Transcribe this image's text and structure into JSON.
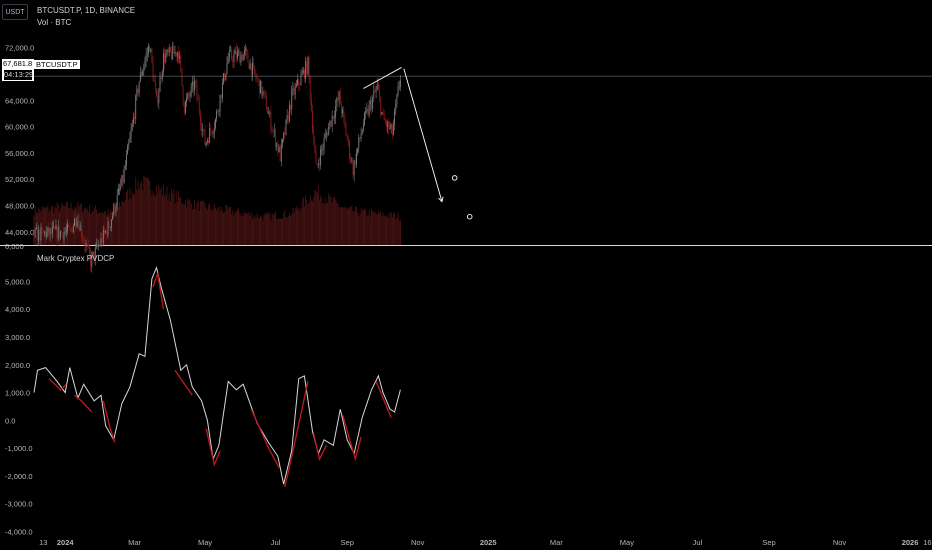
{
  "header": {
    "currency_button": "USDT",
    "symbol_line": "BTCUSDT.P, 1D, BINANCE",
    "volume_line": "Vol · BTC",
    "indicator_line": "Mark Cryptex PVDCP"
  },
  "price_badge": {
    "price": "67,681.8",
    "countdown": "04:13:29",
    "symbol_tag": "BTCUSDT.P"
  },
  "colors": {
    "background": "#000000",
    "candle_up": "#7d7d7d",
    "candle_down": "#8b1a1a",
    "volume": "#4a1414",
    "oscillator_fast": "#c01a1a",
    "oscillator_slow": "#d9d9d9",
    "annotation": "#ffffff"
  },
  "chart_data": [
    {
      "type": "candlestick",
      "name": "BTCUSDT.P",
      "ylim": [
        42000,
        75000
      ],
      "y_ticks": [
        "44,000.0",
        "48,000.0",
        "52,000.0",
        "56,000.0",
        "60,000.0",
        "64,000.0",
        "72,000.0"
      ],
      "y_tick_values": [
        44000,
        48000,
        52000,
        56000,
        60000,
        64000,
        72000
      ],
      "current_price": 67681.8,
      "x_range": [
        "2023-12-05",
        "2026-01-20"
      ],
      "x_ticks": [
        {
          "label": "13",
          "date": "2023-12-13"
        },
        {
          "label": "2024",
          "date": "2024-01-01"
        },
        {
          "label": "Mar",
          "date": "2024-03-01"
        },
        {
          "label": "May",
          "date": "2024-05-01"
        },
        {
          "label": "Jul",
          "date": "2024-07-01"
        },
        {
          "label": "Sep",
          "date": "2024-09-01"
        },
        {
          "label": "Nov",
          "date": "2024-11-01"
        },
        {
          "label": "2025",
          "date": "2025-01-01"
        },
        {
          "label": "Mar",
          "date": "2025-03-01"
        },
        {
          "label": "May",
          "date": "2025-05-01"
        },
        {
          "label": "Jul",
          "date": "2025-07-01"
        },
        {
          "label": "Sep",
          "date": "2025-09-01"
        },
        {
          "label": "Nov",
          "date": "2025-11-01"
        },
        {
          "label": "2026",
          "date": "2026-01-01"
        },
        {
          "label": "16",
          "date": "2026-01-16"
        }
      ],
      "close_path": [
        [
          "2023-12-05",
          43500
        ],
        [
          "2023-12-20",
          43800
        ],
        [
          "2024-01-05",
          44000
        ],
        [
          "2024-01-11",
          46500
        ],
        [
          "2024-01-23",
          39500
        ],
        [
          "2024-02-08",
          45000
        ],
        [
          "2024-02-20",
          52000
        ],
        [
          "2024-02-28",
          60000
        ],
        [
          "2024-03-05",
          67000
        ],
        [
          "2024-03-14",
          72500
        ],
        [
          "2024-03-20",
          63500
        ],
        [
          "2024-03-26",
          70500
        ],
        [
          "2024-04-08",
          71500
        ],
        [
          "2024-04-13",
          63000
        ],
        [
          "2024-04-22",
          66500
        ],
        [
          "2024-05-01",
          57500
        ],
        [
          "2024-05-10",
          61000
        ],
        [
          "2024-05-21",
          70500
        ],
        [
          "2024-06-05",
          71000
        ],
        [
          "2024-06-20",
          65000
        ],
        [
          "2024-07-05",
          55500
        ],
        [
          "2024-07-15",
          64500
        ],
        [
          "2024-07-29",
          69500
        ],
        [
          "2024-08-05",
          53500
        ],
        [
          "2024-08-15",
          59500
        ],
        [
          "2024-08-25",
          64500
        ],
        [
          "2024-09-06",
          53500
        ],
        [
          "2024-09-15",
          60500
        ],
        [
          "2024-09-27",
          66000
        ],
        [
          "2024-10-02",
          61000
        ],
        [
          "2024-10-10",
          59000
        ],
        [
          "2024-10-17",
          67681.8
        ]
      ],
      "volume_series": "Vol · BTC",
      "volume_path": [
        [
          "2023-12-05",
          0.55
        ],
        [
          "2024-01-10",
          0.62
        ],
        [
          "2024-02-10",
          0.5
        ],
        [
          "2024-03-05",
          1.0
        ],
        [
          "2024-03-20",
          0.9
        ],
        [
          "2024-04-20",
          0.65
        ],
        [
          "2024-05-20",
          0.55
        ],
        [
          "2024-06-20",
          0.45
        ],
        [
          "2024-07-15",
          0.5
        ],
        [
          "2024-08-05",
          0.85
        ],
        [
          "2024-09-01",
          0.55
        ],
        [
          "2024-10-17",
          0.45
        ]
      ],
      "annotations": {
        "trendline": [
          [
            "2024-09-15",
            65800
          ],
          [
            "2024-10-18",
            69000
          ]
        ],
        "forecast_arrow": [
          [
            "2024-10-20",
            68800
          ],
          [
            "2024-11-22",
            48600
          ]
        ],
        "markers": [
          [
            "2024-12-03",
            52200
          ],
          [
            "2024-12-16",
            46300
          ]
        ]
      }
    },
    {
      "type": "line",
      "title": "Mark Cryptex PVDCP",
      "ylim": [
        -4200,
        5700
      ],
      "y_ticks": [
        "5,000.0",
        "4,000.0",
        "3,000.0",
        "2,000.0",
        "1,000.0",
        "0.0",
        "-1,000.0",
        "-2,000.0",
        "-3,000.0",
        "-4,000.0"
      ],
      "y_tick_values": [
        5000,
        4000,
        3000,
        2000,
        1000,
        0,
        -1000,
        -2000,
        -3000,
        -4000
      ],
      "series": [
        {
          "color_key": "oscillator_slow",
          "points": [
            [
              "2023-12-05",
              1000
            ],
            [
              "2023-12-08",
              1800
            ],
            [
              "2023-12-15",
              1900
            ],
            [
              "2023-12-25",
              1400
            ],
            [
              "2024-01-01",
              1000
            ],
            [
              "2024-01-05",
              1900
            ],
            [
              "2024-01-12",
              800
            ],
            [
              "2024-01-17",
              1300
            ],
            [
              "2024-01-26",
              700
            ],
            [
              "2024-02-01",
              900
            ],
            [
              "2024-02-05",
              -200
            ],
            [
              "2024-02-12",
              -700
            ],
            [
              "2024-02-19",
              600
            ],
            [
              "2024-02-26",
              1200
            ],
            [
              "2024-03-05",
              2400
            ],
            [
              "2024-03-10",
              2300
            ],
            [
              "2024-03-16",
              5100
            ],
            [
              "2024-03-20",
              5500
            ],
            [
              "2024-03-24",
              4800
            ],
            [
              "2024-04-01",
              3600
            ],
            [
              "2024-04-10",
              1800
            ],
            [
              "2024-04-15",
              2000
            ],
            [
              "2024-04-20",
              1200
            ],
            [
              "2024-04-28",
              700
            ],
            [
              "2024-05-03",
              0
            ],
            [
              "2024-05-08",
              -1400
            ],
            [
              "2024-05-13",
              -900
            ],
            [
              "2024-05-21",
              1400
            ],
            [
              "2024-05-28",
              1100
            ],
            [
              "2024-06-03",
              1300
            ],
            [
              "2024-06-15",
              -100
            ],
            [
              "2024-06-25",
              -800
            ],
            [
              "2024-07-03",
              -1300
            ],
            [
              "2024-07-08",
              -2300
            ],
            [
              "2024-07-15",
              -1100
            ],
            [
              "2024-07-21",
              1500
            ],
            [
              "2024-07-26",
              1600
            ],
            [
              "2024-08-02",
              -400
            ],
            [
              "2024-08-07",
              -1200
            ],
            [
              "2024-08-12",
              -700
            ],
            [
              "2024-08-20",
              -900
            ],
            [
              "2024-08-26",
              400
            ],
            [
              "2024-09-01",
              -700
            ],
            [
              "2024-09-07",
              -1200
            ],
            [
              "2024-09-14",
              100
            ],
            [
              "2024-09-22",
              1100
            ],
            [
              "2024-09-28",
              1600
            ],
            [
              "2024-10-02",
              1000
            ],
            [
              "2024-10-08",
              400
            ],
            [
              "2024-10-12",
              300
            ],
            [
              "2024-10-17",
              1100
            ]
          ]
        },
        {
          "color_key": "oscillator_fast",
          "points": [
            [
              "2023-12-18",
              1500
            ],
            [
              "2023-12-28",
              1100
            ],
            [
              "2024-01-02",
              1300
            ],
            [
              "2024-01-09",
              900
            ],
            [
              "2024-01-15",
              700
            ],
            [
              "2024-01-24",
              300
            ],
            [
              "2024-02-03",
              700
            ],
            [
              "2024-02-09",
              -300
            ],
            [
              "2024-02-13",
              -800
            ],
            [
              "2024-03-17",
              4800
            ],
            [
              "2024-03-21",
              5300
            ],
            [
              "2024-03-26",
              4000
            ],
            [
              "2024-04-05",
              1800
            ],
            [
              "2024-04-10",
              1500
            ],
            [
              "2024-04-20",
              900
            ],
            [
              "2024-05-02",
              -300
            ],
            [
              "2024-05-09",
              -1600
            ],
            [
              "2024-05-14",
              -1100
            ],
            [
              "2024-06-10",
              400
            ],
            [
              "2024-06-25",
              -1000
            ],
            [
              "2024-07-04",
              -1700
            ],
            [
              "2024-07-09",
              -2400
            ],
            [
              "2024-07-14",
              -1500
            ],
            [
              "2024-07-29",
              1400
            ],
            [
              "2024-08-03",
              -500
            ],
            [
              "2024-08-08",
              -1400
            ],
            [
              "2024-08-14",
              -900
            ],
            [
              "2024-08-28",
              200
            ],
            [
              "2024-09-08",
              -1400
            ],
            [
              "2024-09-13",
              -600
            ],
            [
              "2024-09-26",
              1400
            ],
            [
              "2024-10-01",
              900
            ],
            [
              "2024-10-09",
              100
            ]
          ]
        }
      ]
    }
  ]
}
